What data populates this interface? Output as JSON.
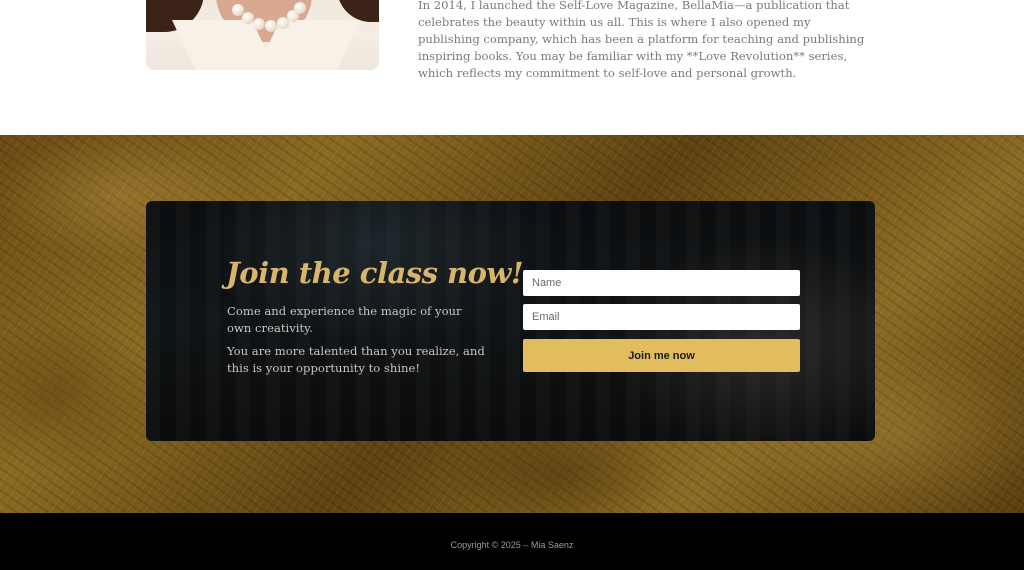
{
  "about": {
    "paragraph": "In 2014, I launched the Self-Love Magazine, BellaMia—a publication that celebrates the beauty within us all. This is where I also opened my publishing company, which has been a platform for teaching and publishing inspiring books. You may be familiar with my **Love Revolution** series, which reflects my commitment to self-love and personal growth.",
    "portrait_icon": "portrait-photo"
  },
  "signup": {
    "title": "Join the class now!",
    "paragraph_1": "Come and experience the magic of your own creativity.",
    "paragraph_2": "You are more talented than you realize, and this is your opportunity to shine!",
    "name_placeholder": "Name",
    "email_placeholder": "Email",
    "submit_label": "Join me now"
  },
  "footer": {
    "copyright": "Copyright © 2025 – Mia Saenz"
  },
  "colors": {
    "accent_gold": "#e2bd5d",
    "title_gold": "#d9b56b",
    "footer_bg": "#000000"
  }
}
